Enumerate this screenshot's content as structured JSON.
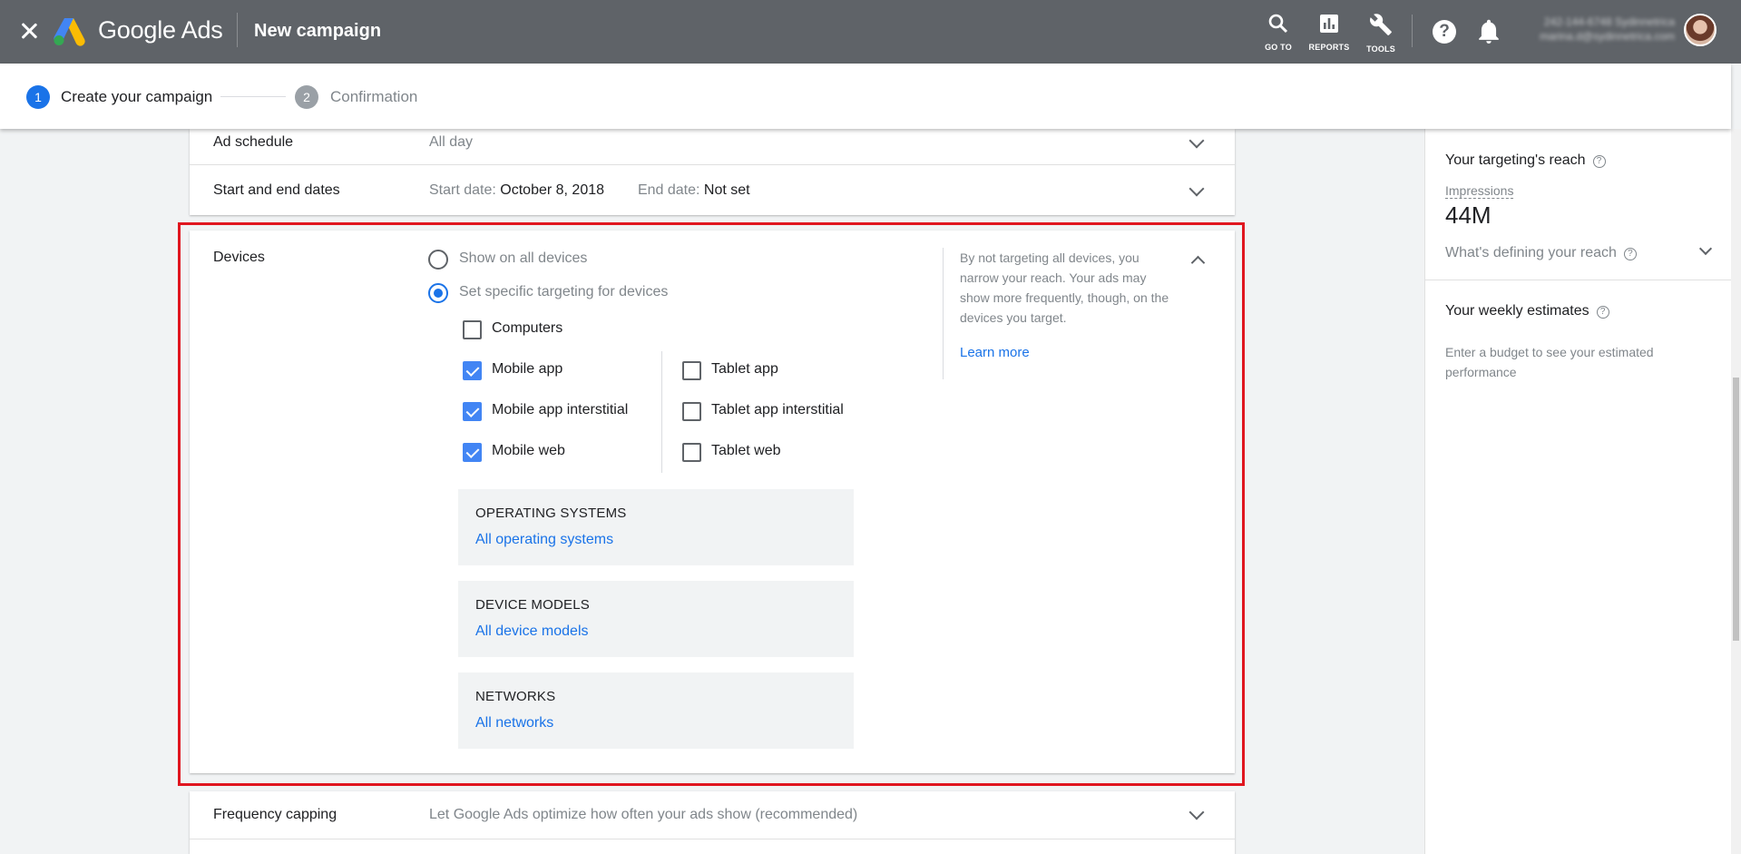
{
  "topbar": {
    "brand": "Google Ads",
    "page_title": "New campaign",
    "goto_label": "GO TO",
    "reports_label": "REPORTS",
    "tools_label": "TOOLS",
    "account_line1": "242-144-6748 Sydinnetrica",
    "account_line2": "marina.d@sydinnetrica.com"
  },
  "stepper": {
    "steps": [
      {
        "number": "1",
        "label": "Create your campaign"
      },
      {
        "number": "2",
        "label": "Confirmation"
      }
    ]
  },
  "settings": {
    "ad_schedule": {
      "label": "Ad schedule",
      "value": "All day"
    },
    "dates": {
      "label": "Start and end dates",
      "start_label": "Start date:",
      "start_value": "October 8, 2018",
      "end_label": "End date:",
      "end_value": "Not set"
    },
    "devices": {
      "label": "Devices",
      "option_all": "Show on all devices",
      "option_specific": "Set specific targeting for devices",
      "computers": "Computers",
      "mobile_app": "Mobile app",
      "mobile_app_interstitial": "Mobile app interstitial",
      "mobile_web": "Mobile web",
      "tablet_app": "Tablet app",
      "tablet_app_interstitial": "Tablet app interstitial",
      "tablet_web": "Tablet web",
      "os_title": "OPERATING SYSTEMS",
      "os_link": "All operating systems",
      "models_title": "DEVICE MODELS",
      "models_link": "All device models",
      "networks_title": "NETWORKS",
      "networks_link": "All networks",
      "note": "By not targeting all devices, you narrow your reach. Your ads may show more frequently, though, on the devices you target.",
      "learn_more": "Learn more"
    },
    "frequency": {
      "label": "Frequency capping",
      "value": "Let Google Ads optimize how often your ads show (recommended)"
    }
  },
  "right_panel": {
    "reach_title": "Your targeting's reach",
    "impressions_label": "Impressions",
    "impressions_value": "44M",
    "defining_label": "What's defining your reach",
    "weekly_title": "Your weekly estimates",
    "weekly_note": "Enter a budget to see your estimated performance"
  },
  "colors": {
    "topbar": "#5f6368",
    "accent": "#1a73e8",
    "checkbox": "#4285f4",
    "highlight": "#e0161f"
  }
}
